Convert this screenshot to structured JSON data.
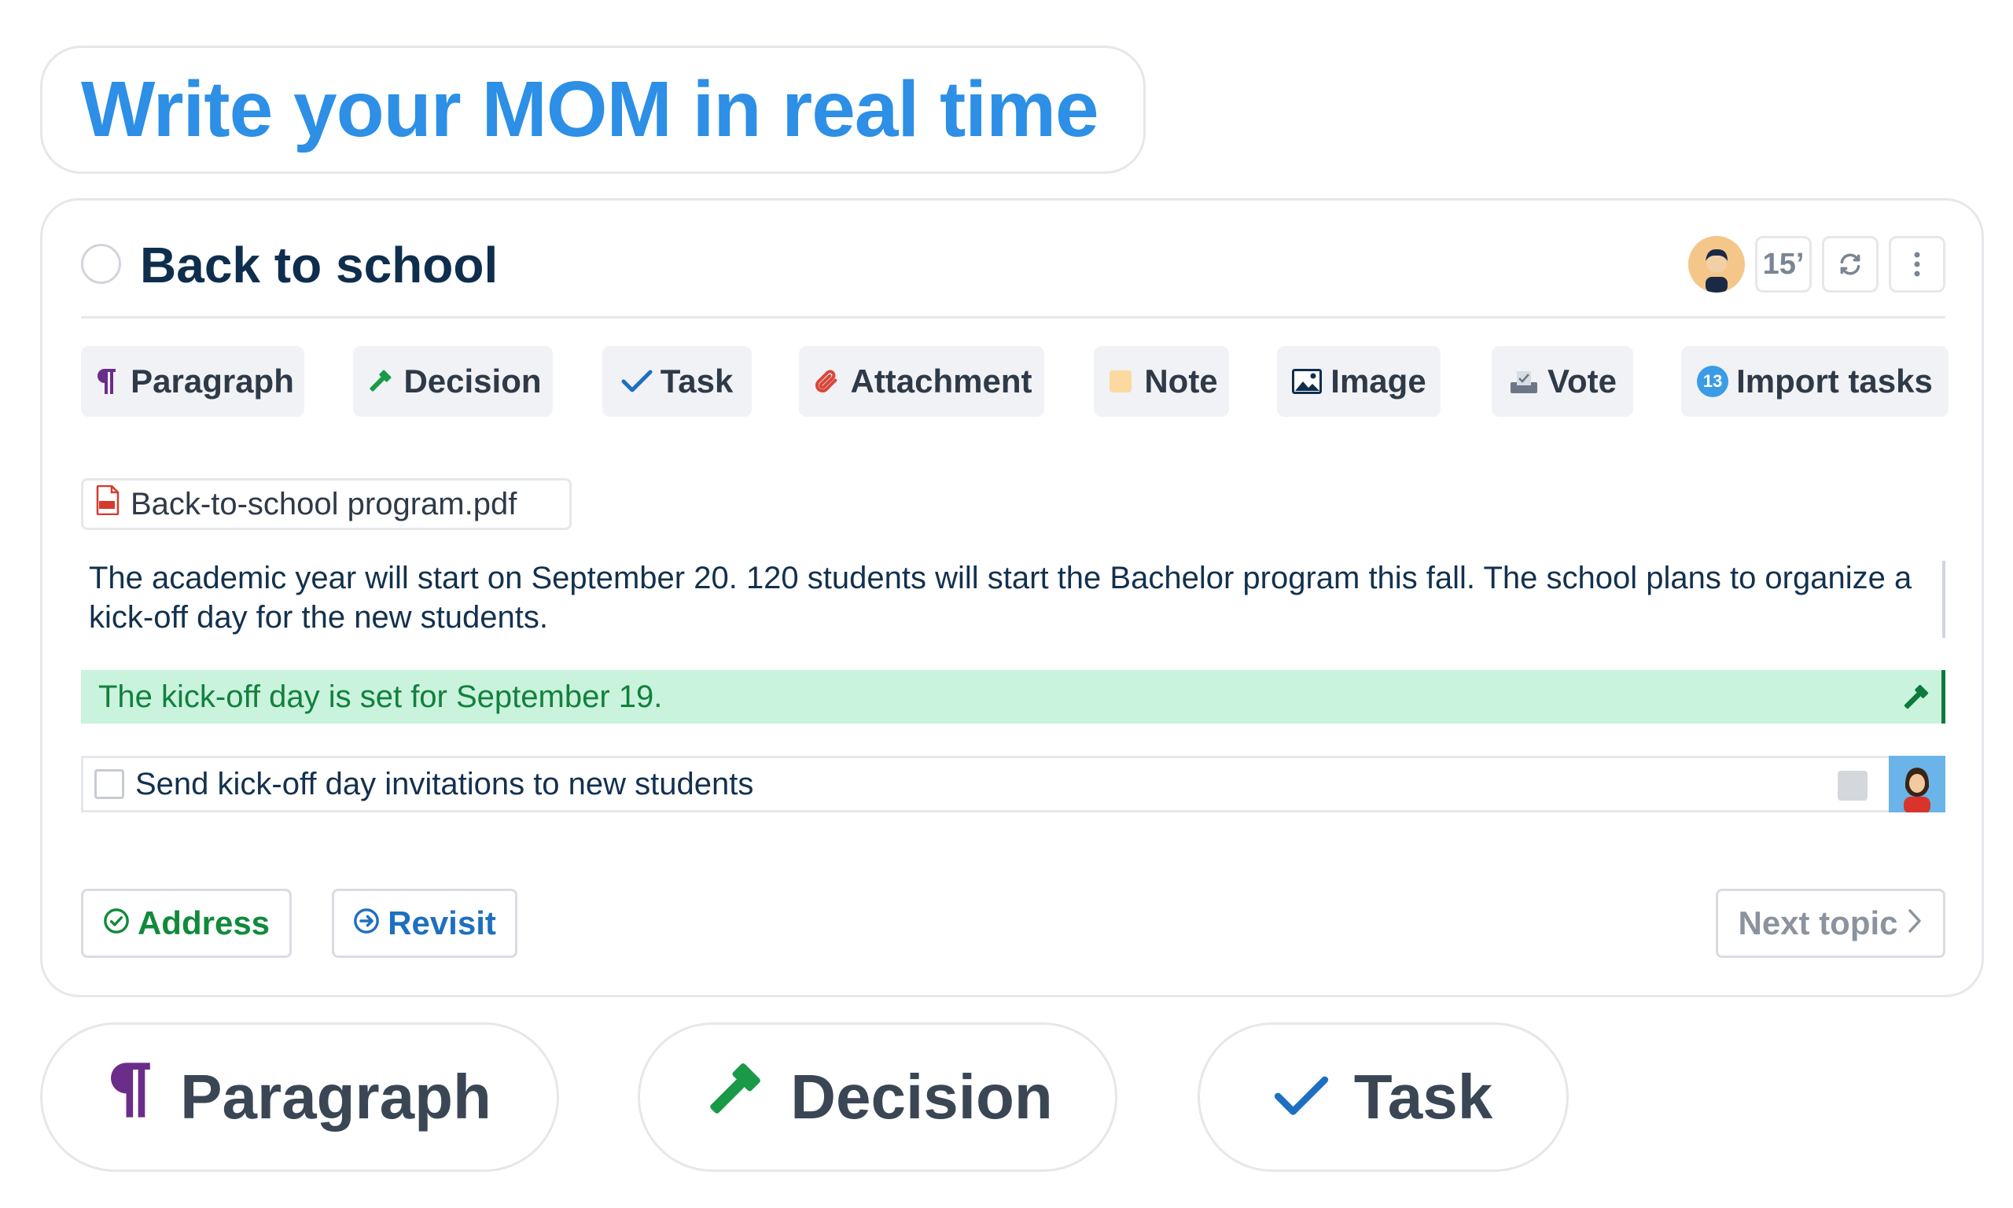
{
  "headline": "Write your MOM in real time",
  "topic": {
    "title": "Back to school",
    "duration": "15’"
  },
  "toolbar": {
    "paragraph": "Paragraph",
    "decision": "Decision",
    "task": "Task",
    "attachment": "Attachment",
    "note": "Note",
    "image": "Image",
    "vote": "Vote",
    "import_tasks": "Import tasks",
    "import_badge": "13"
  },
  "content": {
    "attachment_name": "Back-to-school program.pdf",
    "paragraph_text": "The academic year will start on September 20. 120 students will start the Bachelor program this fall. The school plans to organize a kick-off day for the new students.",
    "decision_text": "The kick-off day is set for September 19.",
    "task_text": "Send kick-off day invitations to new students"
  },
  "footer": {
    "address": "Address",
    "revisit": "Revisit",
    "next_topic": "Next topic"
  },
  "pills": {
    "paragraph": "Paragraph",
    "decision": "Decision",
    "task": "Task"
  },
  "colors": {
    "headline": "#2d8fe5",
    "paragraph_icon": "#6b2d8a",
    "decision_icon": "#1a9a48",
    "task_icon": "#1e6fc0",
    "decision_bg": "#c9f3dc"
  }
}
